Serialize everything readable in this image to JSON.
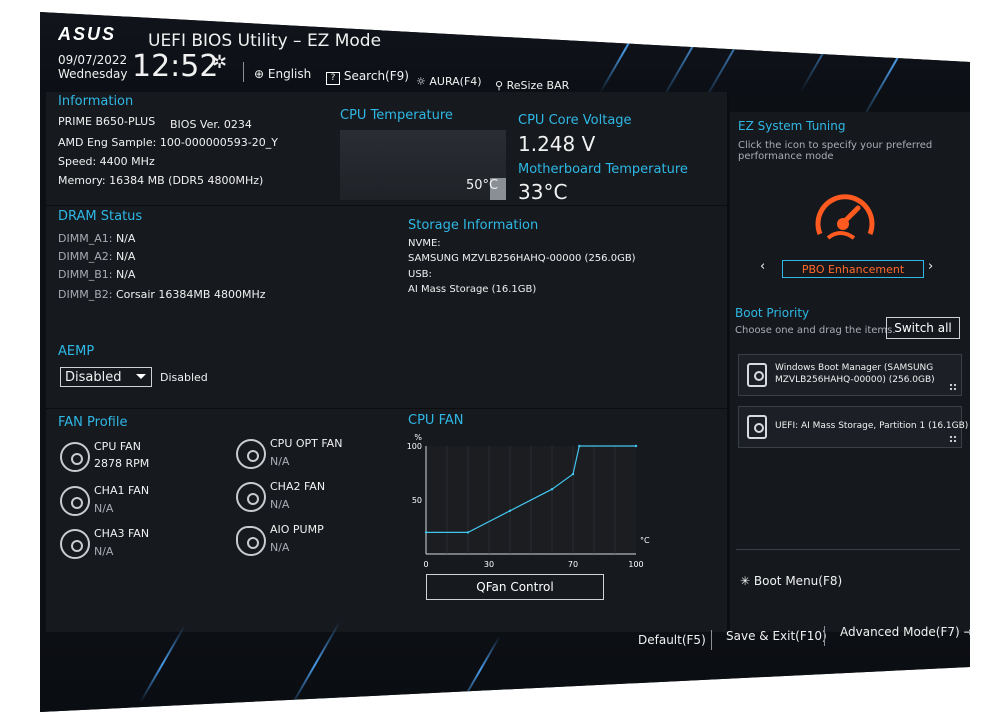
{
  "header": {
    "brand": "ASUS",
    "title": "UEFI BIOS Utility – EZ Mode",
    "date": "09/07/2022",
    "weekday": "Wednesday",
    "time": "12:52",
    "language": "English",
    "search": "Search(F9)",
    "aura": "AURA(F4)",
    "resize_bar": "ReSize BAR"
  },
  "information": {
    "heading": "Information",
    "model": "PRIME B650-PLUS",
    "bios": "BIOS Ver. 0234",
    "cpu": "AMD Eng Sample: 100-000000593-20_Y",
    "speed": "Speed: 4400 MHz",
    "memory": "Memory: 16384 MB (DDR5 4800MHz)"
  },
  "cpu_temp": {
    "heading": "CPU Temperature",
    "value": "50°C"
  },
  "voltage": {
    "heading": "CPU Core Voltage",
    "value": "1.248 V"
  },
  "mb_temp": {
    "heading": "Motherboard Temperature",
    "value": "33°C"
  },
  "dram": {
    "heading": "DRAM Status",
    "slots": [
      {
        "label": "DIMM_A1:",
        "value": "N/A"
      },
      {
        "label": "DIMM_A2:",
        "value": "N/A"
      },
      {
        "label": "DIMM_B1:",
        "value": "N/A"
      },
      {
        "label": "DIMM_B2:",
        "value": "Corsair 16384MB 4800MHz"
      }
    ]
  },
  "storage": {
    "heading": "Storage Information",
    "nvme_label": "NVME:",
    "nvme_value": "SAMSUNG MZVLB256HAHQ-00000 (256.0GB)",
    "usb_label": "USB:",
    "usb_value": "AI Mass Storage (16.1GB)"
  },
  "aemp": {
    "heading": "AEMP",
    "select_value": "Disabled",
    "status": "Disabled"
  },
  "fan_profile": {
    "heading": "FAN Profile",
    "fans": [
      {
        "name": "CPU FAN",
        "value": "2878 RPM"
      },
      {
        "name": "CPU OPT FAN",
        "value": "N/A"
      },
      {
        "name": "CHA1 FAN",
        "value": "N/A"
      },
      {
        "name": "CHA2 FAN",
        "value": "N/A"
      },
      {
        "name": "CHA3 FAN",
        "value": "N/A"
      },
      {
        "name": "AIO PUMP",
        "value": "N/A"
      }
    ]
  },
  "cpu_fan_chart": {
    "heading": "CPU FAN",
    "y_unit": "%",
    "x_unit": "°C",
    "button": "QFan Control"
  },
  "chart_data": {
    "type": "line",
    "title": "CPU FAN",
    "xlabel": "°C",
    "ylabel": "%",
    "xlim": [
      0,
      100
    ],
    "ylim": [
      0,
      100
    ],
    "x_ticks": [
      "0",
      "30",
      "70",
      "100"
    ],
    "y_ticks": [
      "50",
      "100"
    ],
    "series": [
      {
        "values_x": [
          0,
          20,
          40,
          60,
          70,
          73,
          100
        ],
        "values_y": [
          20,
          20,
          40,
          60,
          74,
          100,
          100
        ]
      }
    ]
  },
  "ez_tuning": {
    "heading": "EZ System Tuning",
    "description_1": "Click the icon to specify your preferred",
    "description_2": "performance mode",
    "mode": "PBO Enhancement",
    "accent": "#ff5a1f"
  },
  "boot": {
    "heading": "Boot Priority",
    "hint": "Choose one and drag the items.",
    "switch_all": "Switch all",
    "items": [
      {
        "line1": "Windows Boot Manager (SAMSUNG",
        "line2": "MZVLB256HAHQ-00000) (256.0GB)"
      },
      {
        "line1": "UEFI: AI Mass Storage, Partition 1 (16.1GB)",
        "line2": ""
      }
    ],
    "boot_menu": "Boot Menu(F8)"
  },
  "footer": {
    "default": "Default(F5)",
    "save_exit": "Save & Exit(F10)",
    "advanced": "Advanced Mode(F7)"
  },
  "colors": {
    "accent": "#2fb8e5",
    "background": "#0c0f14",
    "panel": "#16191e"
  }
}
